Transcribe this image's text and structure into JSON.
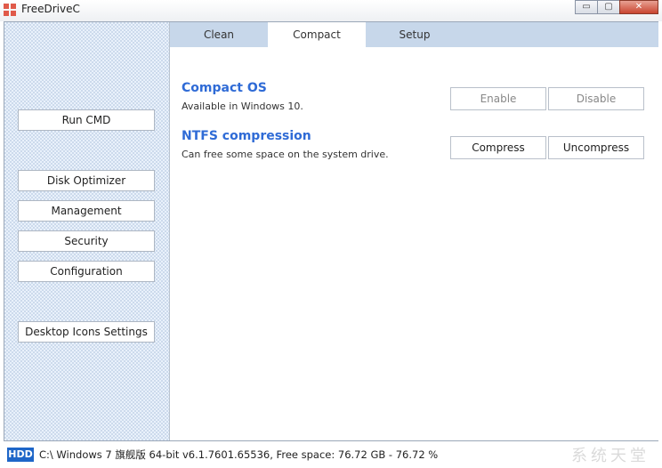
{
  "window": {
    "title": "FreeDriveC",
    "min_label": "▭",
    "max_label": "▢",
    "close_label": "✕"
  },
  "sidebar": {
    "run_cmd": "Run CMD",
    "disk_optimizer": "Disk Optimizer",
    "management": "Management",
    "security": "Security",
    "configuration": "Configuration",
    "desktop_icons": "Desktop Icons Settings"
  },
  "tabs": [
    "Clean",
    "Compact",
    "Setup"
  ],
  "active_tab": "Compact",
  "compact_os": {
    "title": "Compact OS",
    "desc": "Available in Windows 10.",
    "enable": "Enable",
    "disable": "Disable"
  },
  "ntfs": {
    "title": "NTFS compression",
    "desc": "Can free some space on the system drive.",
    "compress": "Compress",
    "uncompress": "Uncompress"
  },
  "status": {
    "badge": "HDD",
    "text": "C:\\ Windows 7 旗舰版  64-bit v6.1.7601.65536, Free space: 76.72 GB - 76.72 %"
  },
  "watermark": "系统天堂",
  "colors": {
    "accent": "#2f6bd6",
    "tab_strip": "#c7d7ea",
    "badge": "#1e66c8",
    "sidebar_bg": "#e9f1fb"
  }
}
